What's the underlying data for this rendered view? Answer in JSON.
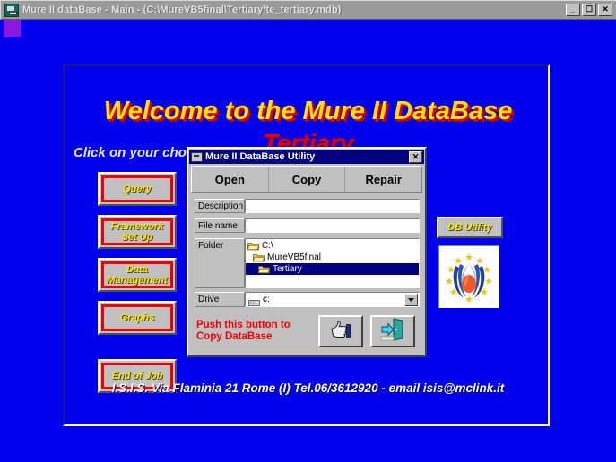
{
  "window": {
    "title": "Mure II dataBase - Main - (C:\\MureVB5final\\Tertiary\\te_tertiary.mdb)",
    "icon": "database-app-icon",
    "controls": {
      "minimize": "_",
      "maximize": "☐",
      "close": "✕"
    }
  },
  "main": {
    "welcome_title": "Welcome to the Mure II DataBase",
    "welcome_subtitle": "Tertiary",
    "prompt": "Click on your choice",
    "footer": "I.S.I.S. Via Flaminia 21 Rome (I) Tel.06/3612920 - email isis@mclink.it",
    "nav_buttons": [
      {
        "id": "query",
        "label": "Query"
      },
      {
        "id": "framework",
        "label": "Framework\nSet Up"
      },
      {
        "id": "data",
        "label": "Data\nManagement"
      },
      {
        "id": "graphs",
        "label": "Graphs"
      },
      {
        "id": "endofjob",
        "label": "End of Job"
      }
    ],
    "db_utility_label": "DB Utility",
    "logo": "eu-laurel-flame-logo",
    "occluded_marks": [
      "’’",
      "’’"
    ]
  },
  "dialog": {
    "title": "Mure II DataBase Utility",
    "icon": "utility-icon",
    "close_label": "✕",
    "tabs": [
      {
        "id": "open",
        "label": "Open"
      },
      {
        "id": "copy",
        "label": "Copy"
      },
      {
        "id": "repair",
        "label": "Repair"
      }
    ],
    "active_tab": "copy",
    "fields": {
      "description": {
        "label": "Description",
        "value": "",
        "placeholder": ""
      },
      "file_name": {
        "label": "File name",
        "value": "",
        "placeholder": ""
      },
      "folder": {
        "label": "Folder"
      },
      "drive": {
        "label": "Drive",
        "value": "c:"
      }
    },
    "folder_items": [
      {
        "label": "C:\\",
        "indent": 0,
        "selected": false,
        "icon": "folder-open-icon"
      },
      {
        "label": "MureVB5final",
        "indent": 1,
        "selected": false,
        "icon": "folder-open-icon"
      },
      {
        "label": "Tertiary",
        "indent": 2,
        "selected": true,
        "icon": "folder-open-icon"
      }
    ],
    "copy_hint": "Push this button to\nCopy DataBase",
    "confirm_icon": "thumbs-up-icon",
    "exit_icon": "exit-door-icon"
  },
  "colors": {
    "desktop_blue": "#0000ee",
    "title_yellow": "#ffe400",
    "title_red": "#e00000",
    "accent_red": "#ee0000",
    "dialog_titlebar": "#000080",
    "face_gray": "#c0c0c0"
  }
}
